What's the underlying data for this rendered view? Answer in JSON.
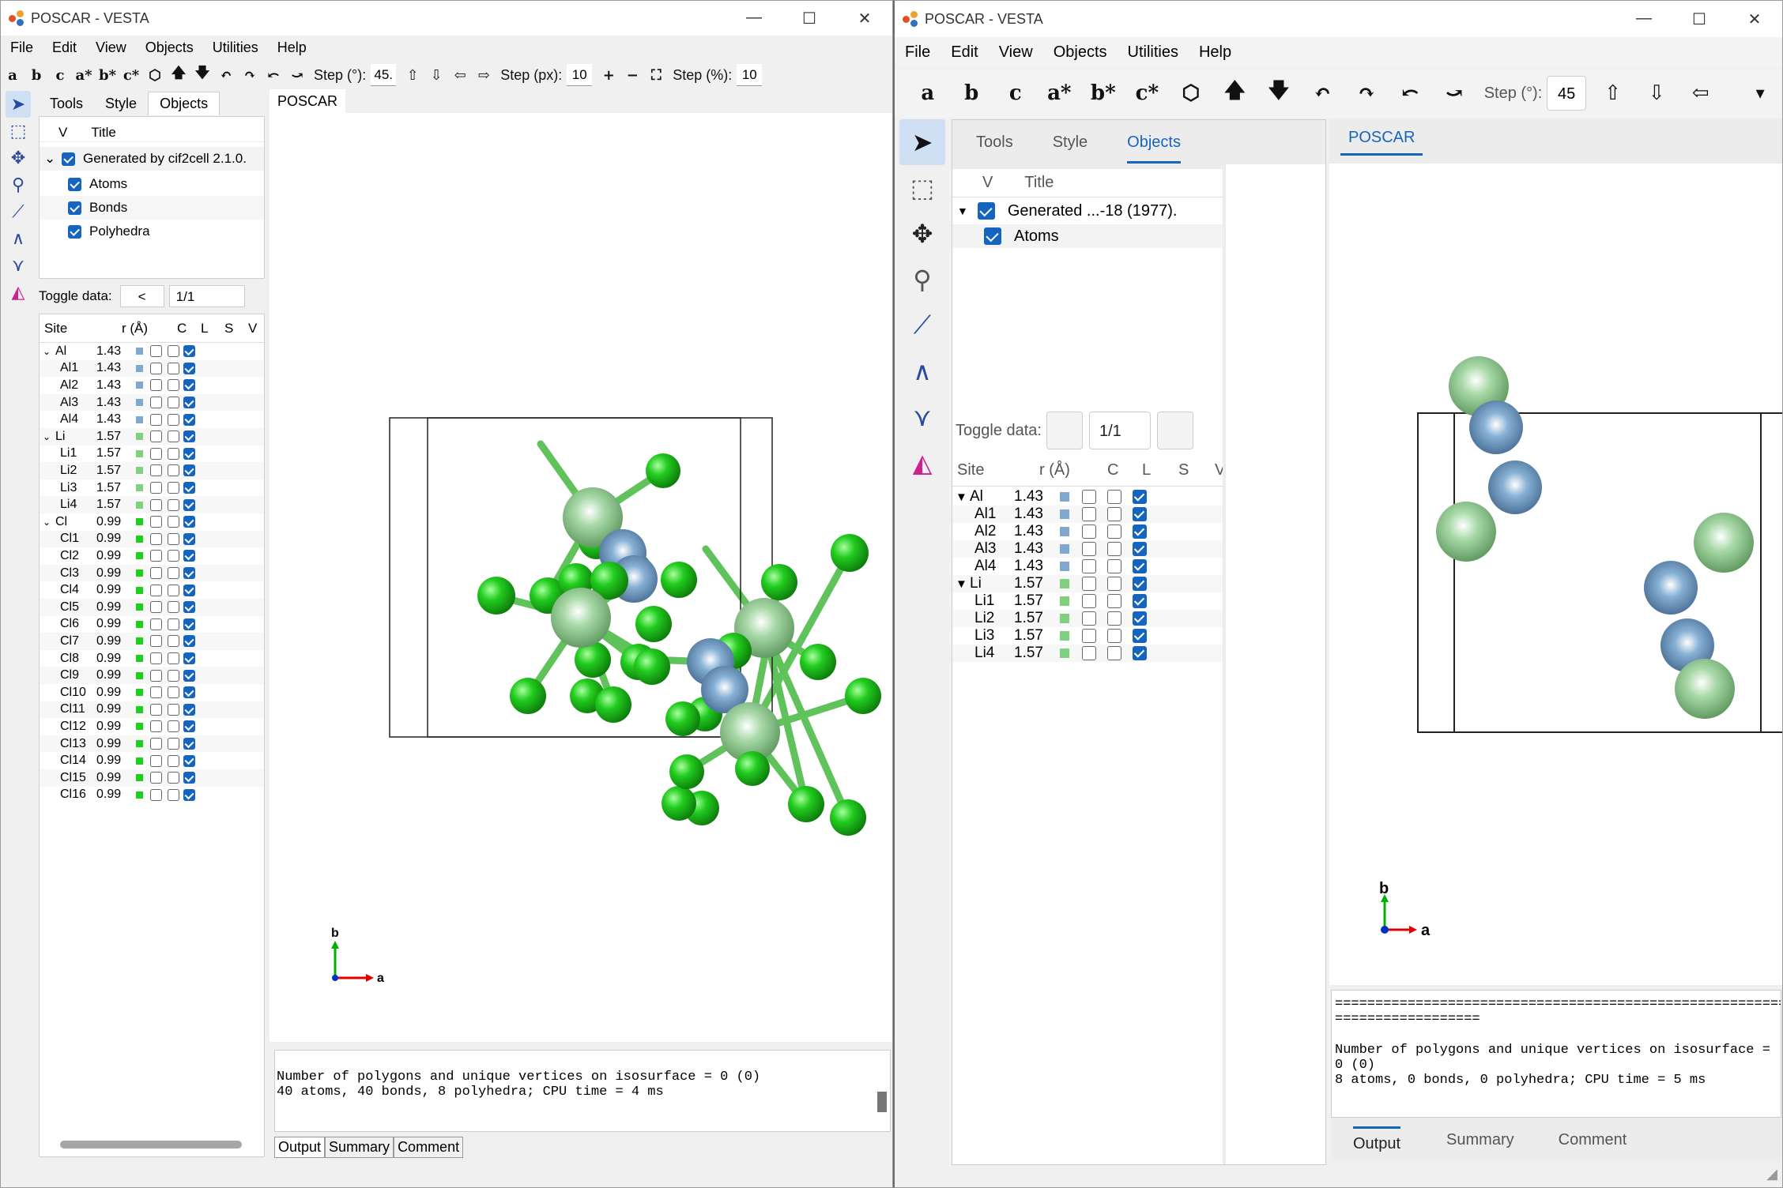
{
  "left": {
    "title": "POSCAR - VESTA",
    "menu": [
      "File",
      "Edit",
      "View",
      "Objects",
      "Utilities",
      "Help"
    ],
    "toolbar": {
      "axes": [
        "a",
        "b",
        "c",
        "a*",
        "b*",
        "c*"
      ],
      "step_deg_label": "Step (°):",
      "step_deg": "45.",
      "step_px_label": "Step (px):",
      "step_px": "10",
      "step_pct_label": "Step (%):",
      "step_pct": "10"
    },
    "tabs": [
      "Tools",
      "Style",
      "Objects"
    ],
    "active_tab": "Objects",
    "tree_headers": {
      "v": "V",
      "title": "Title"
    },
    "tree": [
      "Generated by cif2cell 2.1.0.",
      "Atoms",
      "Bonds",
      "Polyhedra"
    ],
    "toggle_label": "Toggle data:",
    "toggle_btn": "<",
    "toggle_value": "1/1",
    "site_headers": [
      "Site",
      "r (Å)",
      "C",
      "L",
      "S",
      "V"
    ],
    "sites": [
      {
        "name": "Al",
        "r": "1.43",
        "group": true,
        "color": "#7fa8d0"
      },
      {
        "name": "Al1",
        "r": "1.43",
        "color": "#7fa8d0"
      },
      {
        "name": "Al2",
        "r": "1.43",
        "color": "#7fa8d0"
      },
      {
        "name": "Al3",
        "r": "1.43",
        "color": "#7fa8d0"
      },
      {
        "name": "Al4",
        "r": "1.43",
        "color": "#7fa8d0"
      },
      {
        "name": "Li",
        "r": "1.57",
        "group": true,
        "color": "#7fd07f"
      },
      {
        "name": "Li1",
        "r": "1.57",
        "color": "#7fd07f"
      },
      {
        "name": "Li2",
        "r": "1.57",
        "color": "#7fd07f"
      },
      {
        "name": "Li3",
        "r": "1.57",
        "color": "#7fd07f"
      },
      {
        "name": "Li4",
        "r": "1.57",
        "color": "#7fd07f"
      },
      {
        "name": "Cl",
        "r": "0.99",
        "group": true,
        "color": "#1ed01e"
      },
      {
        "name": "Cl1",
        "r": "0.99",
        "color": "#1ed01e"
      },
      {
        "name": "Cl2",
        "r": "0.99",
        "color": "#1ed01e"
      },
      {
        "name": "Cl3",
        "r": "0.99",
        "color": "#1ed01e"
      },
      {
        "name": "Cl4",
        "r": "0.99",
        "color": "#1ed01e"
      },
      {
        "name": "Cl5",
        "r": "0.99",
        "color": "#1ed01e"
      },
      {
        "name": "Cl6",
        "r": "0.99",
        "color": "#1ed01e"
      },
      {
        "name": "Cl7",
        "r": "0.99",
        "color": "#1ed01e"
      },
      {
        "name": "Cl8",
        "r": "0.99",
        "color": "#1ed01e"
      },
      {
        "name": "Cl9",
        "r": "0.99",
        "color": "#1ed01e"
      },
      {
        "name": "Cl10",
        "r": "0.99",
        "color": "#1ed01e"
      },
      {
        "name": "Cl11",
        "r": "0.99",
        "color": "#1ed01e"
      },
      {
        "name": "Cl12",
        "r": "0.99",
        "color": "#1ed01e"
      },
      {
        "name": "Cl13",
        "r": "0.99",
        "color": "#1ed01e"
      },
      {
        "name": "Cl14",
        "r": "0.99",
        "color": "#1ed01e"
      },
      {
        "name": "Cl15",
        "r": "0.99",
        "color": "#1ed01e"
      },
      {
        "name": "Cl16",
        "r": "0.99",
        "color": "#1ed01e"
      }
    ],
    "viewer_tab": "POSCAR",
    "axis_labels": {
      "a": "a",
      "b": "b"
    },
    "console": [
      "Number of polygons and unique vertices on isosurface = 0 (0)",
      "40 atoms, 40 bonds, 8 polyhedra; CPU time = 4 ms"
    ],
    "bottom_tabs": [
      "Output",
      "Summary",
      "Comment"
    ]
  },
  "right": {
    "title": "POSCAR - VESTA",
    "menu": [
      "File",
      "Edit",
      "View",
      "Objects",
      "Utilities",
      "Help"
    ],
    "toolbar": {
      "axes": [
        "a",
        "b",
        "c",
        "a*",
        "b*",
        "c*"
      ],
      "step_deg_label": "Step (°):",
      "step_deg": "45"
    },
    "tabs": [
      "Tools",
      "Style",
      "Objects"
    ],
    "active_tab": "Objects",
    "tree_headers": {
      "v": "V",
      "title": "Title"
    },
    "tree": [
      "Generated ...-18 (1977).",
      "Atoms"
    ],
    "toggle_label": "Toggle data:",
    "toggle_value": "1/1",
    "site_headers": [
      "Site",
      "r (Å)",
      "C",
      "L",
      "S",
      "V"
    ],
    "sites": [
      {
        "name": "Al",
        "r": "1.43",
        "group": true,
        "color": "#7fa8d0"
      },
      {
        "name": "Al1",
        "r": "1.43",
        "color": "#7fa8d0"
      },
      {
        "name": "Al2",
        "r": "1.43",
        "color": "#7fa8d0"
      },
      {
        "name": "Al3",
        "r": "1.43",
        "color": "#7fa8d0"
      },
      {
        "name": "Al4",
        "r": "1.43",
        "color": "#7fa8d0"
      },
      {
        "name": "Li",
        "r": "1.57",
        "group": true,
        "color": "#7fd07f"
      },
      {
        "name": "Li1",
        "r": "1.57",
        "color": "#7fd07f"
      },
      {
        "name": "Li2",
        "r": "1.57",
        "color": "#7fd07f"
      },
      {
        "name": "Li3",
        "r": "1.57",
        "color": "#7fd07f"
      },
      {
        "name": "Li4",
        "r": "1.57",
        "color": "#7fd07f"
      }
    ],
    "viewer_tab": "POSCAR",
    "axis_labels": {
      "a": "a",
      "b": "b"
    },
    "console": [
      "================================================================================",
      "==================",
      "",
      "Number of polygons and unique vertices on isosurface = 0 (0)",
      "8 atoms, 0 bonds, 0 polyhedra; CPU time = 5 ms"
    ],
    "bottom_tabs": [
      "Output",
      "Summary",
      "Comment"
    ]
  },
  "colors": {
    "accent": "#1565c0",
    "al": "#7fa8d0",
    "li": "#7fd07f",
    "cl": "#1ed01e"
  }
}
